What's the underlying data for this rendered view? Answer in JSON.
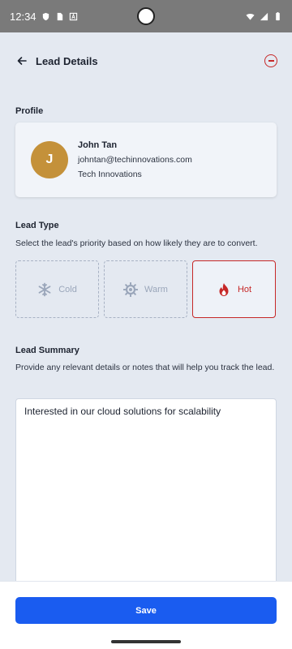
{
  "status_bar": {
    "time": "12:34"
  },
  "header": {
    "title": "Lead Details"
  },
  "profile": {
    "section_label": "Profile",
    "initial": "J",
    "name": "John Tan",
    "email": "johntan@techinnovations.com",
    "company": "Tech Innovations",
    "avatar_color": "#c4913a"
  },
  "lead_type": {
    "section_label": "Lead Type",
    "description": "Select the lead's priority based on how likely they are to convert.",
    "options": [
      {
        "label": "Cold",
        "icon": "snowflake-icon",
        "selected": false
      },
      {
        "label": "Warm",
        "icon": "sun-icon",
        "selected": false
      },
      {
        "label": "Hot",
        "icon": "fire-icon",
        "selected": true
      }
    ],
    "active_color": "#c62828"
  },
  "lead_summary": {
    "section_label": "Lead Summary",
    "description": "Provide any relevant details or notes that will help you track the lead.",
    "value": "Interested in our cloud solutions for scalability"
  },
  "footer": {
    "save_label": "Save",
    "button_color": "#1a5cf0"
  }
}
